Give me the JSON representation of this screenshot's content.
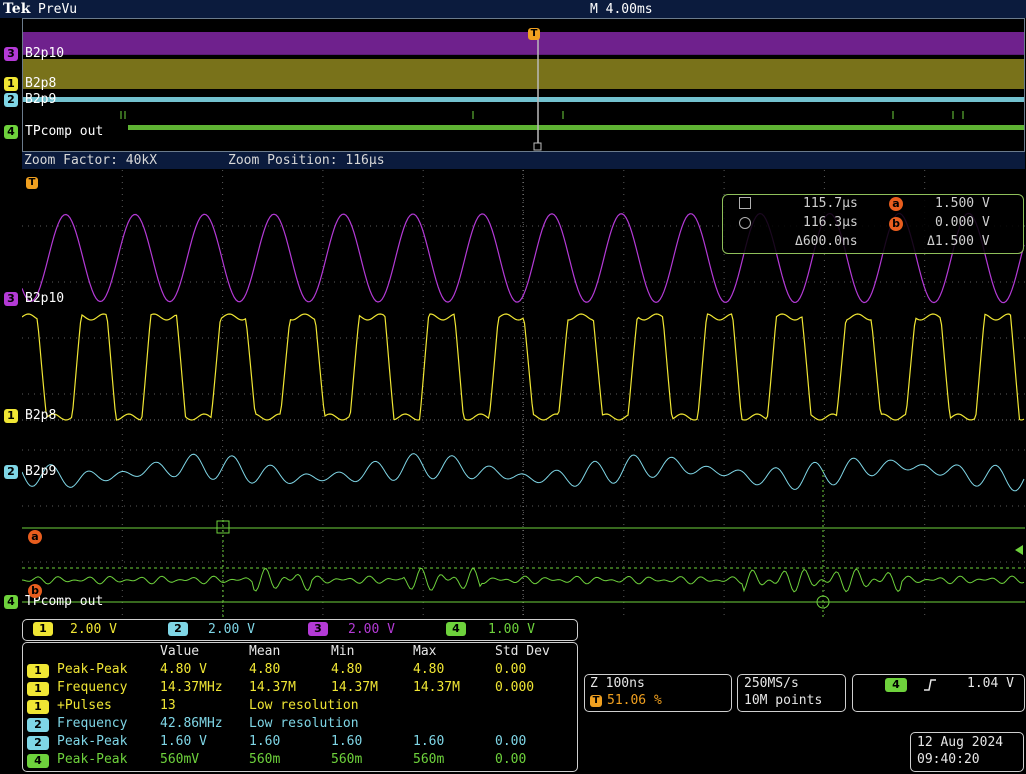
{
  "colors": {
    "ch1": "#f0e634",
    "ch2": "#7fd6e6",
    "ch3": "#b43ad6",
    "ch4": "#6ed23c",
    "trigger": "#f0a020",
    "ref": "#e85d1e",
    "grid": "#5a5a5a",
    "header_bg": "#0b1b3d"
  },
  "topbar": {
    "logo": "Tek",
    "run_state": "PreVu",
    "timebase": "M 4.00ms"
  },
  "overview": {
    "channels": [
      {
        "marker": "3",
        "label": "B2p10"
      },
      {
        "marker": "1",
        "label": "B2p8"
      },
      {
        "marker": "2",
        "label": "B2p9"
      },
      {
        "marker": "4",
        "label": "TPcomp out"
      }
    ],
    "trigger_marker": "T"
  },
  "zoom_bar": {
    "factor": "Zoom Factor: 40kX",
    "position": "Zoom Position: 116µs"
  },
  "graticule": {
    "trigger_marker": "T",
    "channels": [
      {
        "marker": "3",
        "label": "B2p10"
      },
      {
        "marker": "1",
        "label": "B2p8"
      },
      {
        "marker": "2",
        "label": "B2p9"
      },
      {
        "marker": "4",
        "label": "TPcomp out"
      }
    ],
    "ref_a": "a",
    "ref_b": "b"
  },
  "cursors": {
    "t1": "115.7µs",
    "t2": "116.3µs",
    "dt": "Δ600.0ns",
    "a_label": "a",
    "a_value": "1.500 V",
    "b_label": "b",
    "b_value": "0.000 V",
    "dv": "Δ1.500 V"
  },
  "scales": [
    {
      "marker": "1",
      "value": "2.00 V"
    },
    {
      "marker": "2",
      "value": "2.00 V"
    },
    {
      "marker": "3",
      "value": "2.00 V"
    },
    {
      "marker": "4",
      "value": "1.00 V"
    }
  ],
  "measurements": {
    "headers": [
      "Value",
      "Mean",
      "Min",
      "Max",
      "Std Dev"
    ],
    "rows": [
      {
        "ch": "1",
        "name": "Peak-Peak",
        "value": "4.80 V",
        "mean": "4.80",
        "min": "4.80",
        "max": "4.80",
        "std": "0.00"
      },
      {
        "ch": "1",
        "name": "Frequency",
        "value": "14.37MHz",
        "mean": "14.37M",
        "min": "14.37M",
        "max": "14.37M",
        "std": "0.000"
      },
      {
        "ch": "1",
        "name": "+Pulses",
        "value": "13",
        "mean": "Low resolution",
        "min": "",
        "max": "",
        "std": ""
      },
      {
        "ch": "2",
        "name": "Frequency",
        "value": "42.86MHz",
        "mean": "Low resolution",
        "min": "",
        "max": "",
        "std": ""
      },
      {
        "ch": "2",
        "name": "Peak-Peak",
        "value": "1.60 V",
        "mean": "1.60",
        "min": "1.60",
        "max": "1.60",
        "std": "0.00"
      },
      {
        "ch": "4",
        "name": "Peak-Peak",
        "value": "560mV",
        "mean": "560m",
        "min": "560m",
        "max": "560m",
        "std": "0.00"
      }
    ]
  },
  "zoom_panel": {
    "scale": "Z 100ns",
    "trigger_marker": "T",
    "position": "51.06 %"
  },
  "acq_panel": {
    "rate": "250MS/s",
    "length": "10M points"
  },
  "trigger_panel": {
    "channel": "4",
    "slope_icon": "rising-edge-icon",
    "level": "1.04 V"
  },
  "datetime": {
    "date": "12 Aug 2024",
    "time": "09:40:20"
  }
}
